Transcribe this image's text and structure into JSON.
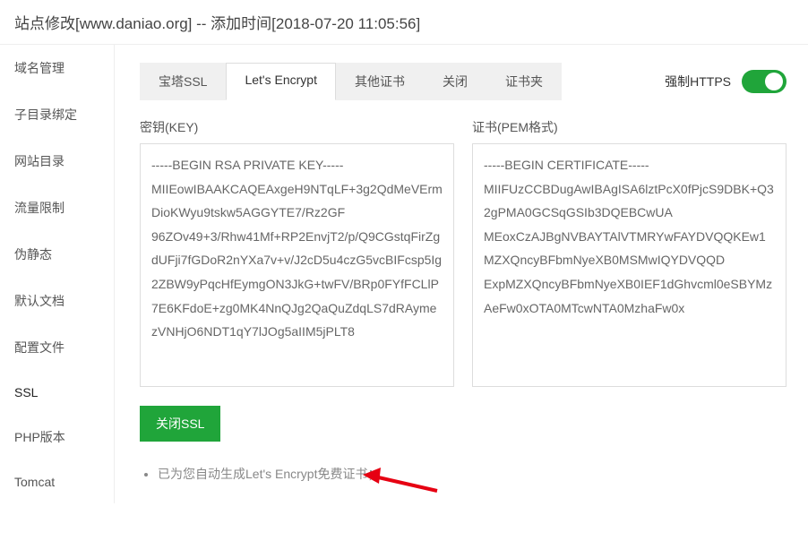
{
  "header": {
    "title": "站点修改[www.daniao.org] -- 添加时间[2018-07-20 11:05:56]"
  },
  "sidebar": {
    "items": [
      {
        "label": "域名管理"
      },
      {
        "label": "子目录绑定"
      },
      {
        "label": "网站目录"
      },
      {
        "label": "流量限制"
      },
      {
        "label": "伪静态"
      },
      {
        "label": "默认文档"
      },
      {
        "label": "配置文件"
      },
      {
        "label": "SSL"
      },
      {
        "label": "PHP版本"
      },
      {
        "label": "Tomcat"
      }
    ]
  },
  "tabs": {
    "items": [
      {
        "label": "宝塔SSL"
      },
      {
        "label": "Let's Encrypt"
      },
      {
        "label": "其他证书"
      },
      {
        "label": "关闭"
      },
      {
        "label": "证书夹"
      }
    ]
  },
  "https": {
    "label": "强制HTTPS",
    "enabled": true
  },
  "cert": {
    "key_label": "密钥(KEY)",
    "pem_label": "证书(PEM格式)",
    "key_value": "-----BEGIN RSA PRIVATE KEY-----\nMIIEowIBAAKCAQEAxgeH9NTqLF+3g2QdMeVErmDioKWyu9tskw5AGGYTE7/Rz2GF\n96ZOv49+3/Rhw41Mf+RP2EnvjT2/p/Q9CGstqFirZgdUFji7fGDoR2nYXa7v+v/J2cD5u4czG5vcBIFcsp5Ig2ZBW9yPqcHfEymgON3JkG+twFV/BRp0FYfFCLlP7E6KFdoE+zg0MK4NnQJg2QaQuZdqLS7dRAymezVNHjO6NDT1qY7lJOg5aIIM5jPLT8",
    "pem_value": "-----BEGIN CERTIFICATE-----\nMIIFUzCCBDugAwIBAgISA6lztPcX0fPjcS9DBK+Q32gPMA0GCSqGSIb3DQEBCwUA\nMEoxCzAJBgNVBAYTAlVTMRYwFAYDVQQKEw1MZXQncyBFbmNyeXB0MSMwIQYDVQQD\nExpMZXQncyBFbmNyeXB0IEF1dGhvcml0eSBYMzAeFw0xOTA0MTcwNTA0MzhaFw0x"
  },
  "buttons": {
    "close_ssl": "关闭SSL"
  },
  "info": {
    "items": [
      "已为您自动生成Let's Encrypt免费证书；"
    ]
  },
  "colors": {
    "green": "#20a53a",
    "arrow": "#e60012"
  }
}
